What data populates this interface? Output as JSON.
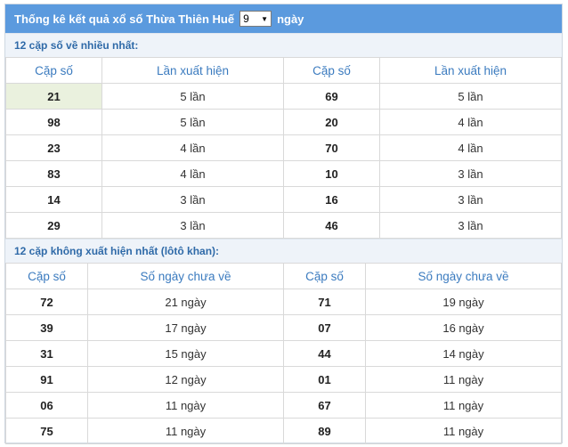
{
  "header": {
    "title": "Thống kê kết quả xổ số Thừa Thiên Huế",
    "select_value": "9",
    "suffix": "ngày"
  },
  "most_frequent": {
    "label": "12 cặp số về nhiều nhất:",
    "columns": [
      "Cặp số",
      "Lần xuất hiện",
      "Cặp số",
      "Lần xuất hiện"
    ],
    "rows": [
      [
        "21",
        "5 lần",
        "69",
        "5 lần"
      ],
      [
        "98",
        "5 lần",
        "20",
        "4 lần"
      ],
      [
        "23",
        "4 lần",
        "70",
        "4 lần"
      ],
      [
        "83",
        "4 lần",
        "10",
        "3 lần"
      ],
      [
        "14",
        "3 lần",
        "16",
        "3 lần"
      ],
      [
        "29",
        "3 lần",
        "46",
        "3 lần"
      ]
    ]
  },
  "least_frequent": {
    "label": "12 cặp không xuất hiện nhất (lôtô khan):",
    "columns": [
      "Cặp số",
      "Số ngày chưa về",
      "Cặp số",
      "Số ngày chưa về"
    ],
    "rows": [
      [
        "72",
        "21 ngày",
        "71",
        "19 ngày"
      ],
      [
        "39",
        "17 ngày",
        "07",
        "16 ngày"
      ],
      [
        "31",
        "15 ngày",
        "44",
        "14 ngày"
      ],
      [
        "91",
        "12 ngày",
        "01",
        "11 ngày"
      ],
      [
        "06",
        "11 ngày",
        "67",
        "11 ngày"
      ],
      [
        "75",
        "11 ngày",
        "89",
        "11 ngày"
      ]
    ]
  },
  "colors": {
    "header_bg": "#5b9ade",
    "column_header_text": "#3b7bbf",
    "highlight_cell": "#eaf1de"
  }
}
